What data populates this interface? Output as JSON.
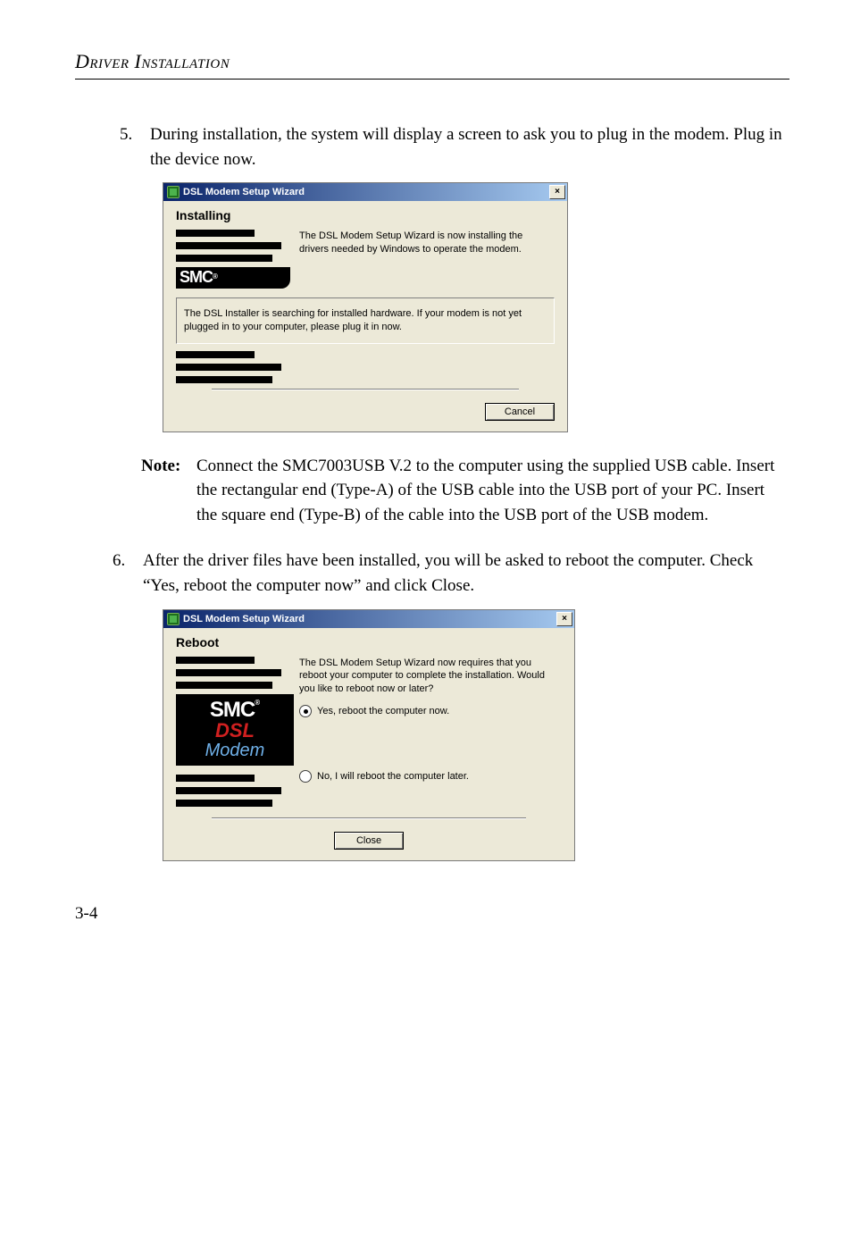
{
  "section_title": "Driver Installation",
  "step5": {
    "num": "5.",
    "text": "During installation, the system will display a screen to ask you to plug in the modem. Plug in the device now."
  },
  "note": {
    "label": "Note:",
    "text": "Connect the SMC7003USB V.2 to the computer using the supplied USB cable. Insert the rectangular end (Type-A) of the USB cable into the USB port of your PC. Insert the square end (Type-B) of the cable into the USB port of the USB modem."
  },
  "step6": {
    "num": "6.",
    "text": "After the driver files have been installed, you will be asked to reboot the computer. Check “Yes, reboot the computer now” and click Close."
  },
  "dialog1": {
    "title": "DSL Modem Setup Wizard",
    "heading": "Installing",
    "body_text": "The DSL Modem Setup Wizard is now installing the drivers needed by Windows to operate the modem.",
    "inset_text": "The DSL Installer is searching for installed hardware.  If your modem is not yet plugged in to your computer, please plug it in now.",
    "cancel": "Cancel",
    "close_x": "×"
  },
  "dialog2": {
    "title": "DSL Modem Setup Wizard",
    "heading": "Reboot",
    "body_text": "The DSL Modem Setup Wizard now requires that you reboot your computer to complete the installation.  Would you like to reboot now or later?",
    "opt_yes": "Yes, reboot the computer now.",
    "opt_no": "No, I will reboot the computer later.",
    "close": "Close",
    "close_x": "×",
    "brand": {
      "smc": "SMC",
      "reg": "®",
      "dsl": "DSL",
      "modem": "Modem"
    }
  },
  "page_number": "3-4"
}
